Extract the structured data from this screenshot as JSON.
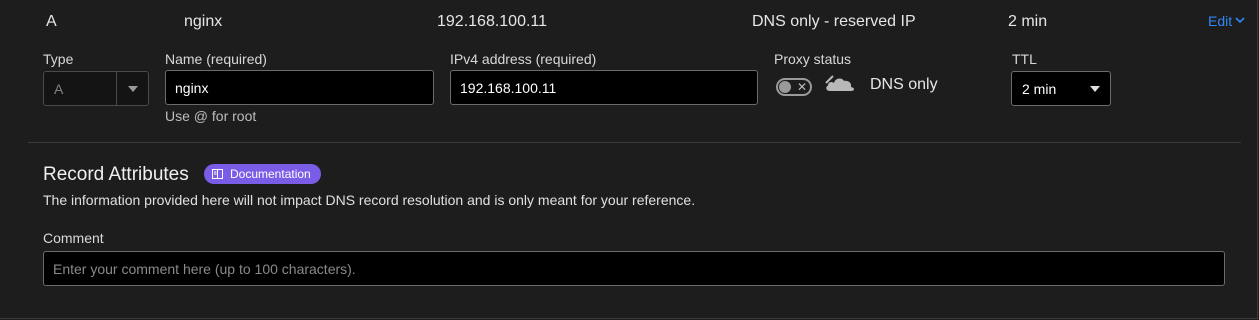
{
  "record": {
    "type": "A",
    "name": "nginx",
    "content": "192.168.100.11",
    "proxy_status": "DNS only - reserved IP",
    "ttl": "2 min",
    "edit_label": "Edit"
  },
  "form": {
    "type_label": "Type",
    "type_value": "A",
    "name_label": "Name (required)",
    "name_value": "nginx",
    "name_hint": "Use @ for root",
    "ipv4_label": "IPv4 address (required)",
    "ipv4_value": "192.168.100.11",
    "proxy_label": "Proxy status",
    "proxy_toggle_on": false,
    "proxy_value": "DNS only",
    "ttl_label": "TTL",
    "ttl_value": "2 min"
  },
  "attributes": {
    "title": "Record Attributes",
    "doc_badge": "Documentation",
    "description": "The information provided here will not impact DNS record resolution and is only meant for your reference.",
    "comment_label": "Comment",
    "comment_placeholder": "Enter your comment here (up to 100 characters)."
  },
  "colors": {
    "accent_link": "#2f86f6",
    "badge": "#7a5ce6",
    "background": "#1d1d1d"
  },
  "icons": [
    "chevron-down-icon",
    "book-icon",
    "cloud-icon",
    "close-icon"
  ]
}
